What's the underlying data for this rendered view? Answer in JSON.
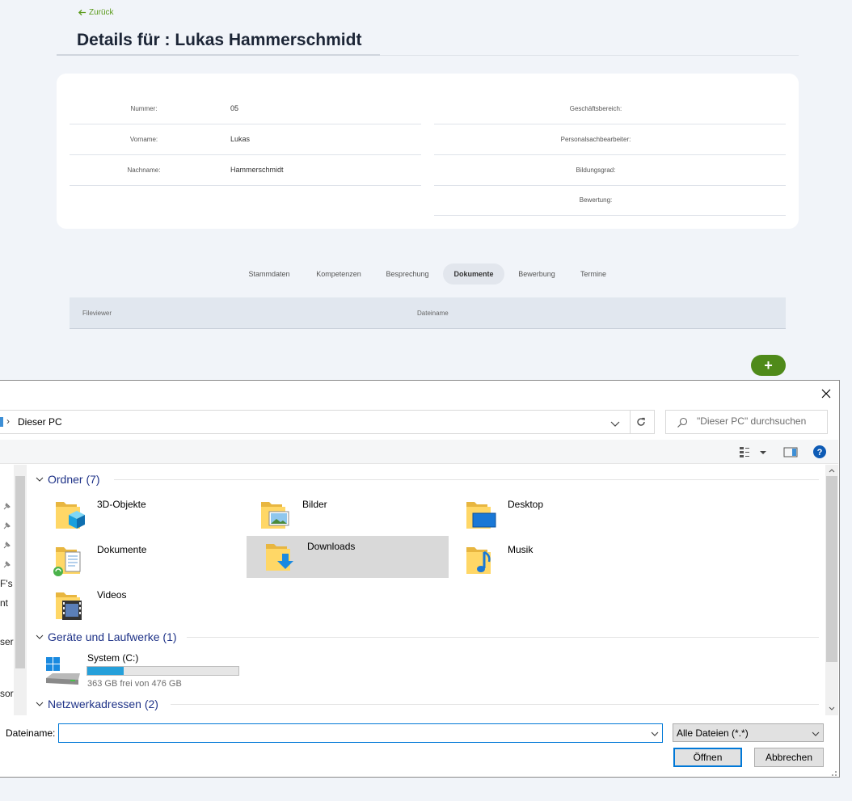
{
  "page": {
    "back_label": "Zurück",
    "title": "Details für : Lukas Hammerschmidt"
  },
  "details": {
    "left": [
      {
        "label": "Nummer:",
        "value": "05"
      },
      {
        "label": "Vorname:",
        "value": "Lukas"
      },
      {
        "label": "Nachname:",
        "value": "Hammerschmidt"
      }
    ],
    "right": [
      {
        "label": "Geschäftsbereich:"
      },
      {
        "label": "Personalsachbearbeiter:"
      },
      {
        "label": "Bildungsgrad:"
      },
      {
        "label": "Bewertung:"
      }
    ]
  },
  "tabs": [
    {
      "label": "Stammdaten"
    },
    {
      "label": "Kompetenzen"
    },
    {
      "label": "Besprechung"
    },
    {
      "label": "Dokumente",
      "active": true
    },
    {
      "label": "Bewerbung"
    },
    {
      "label": "Termine"
    }
  ],
  "table": {
    "columns": [
      "Fileviewer",
      "Dateiname"
    ]
  },
  "add_button": {
    "label": "+",
    "color": "#4f8a1a"
  },
  "dialog": {
    "address_path": "Dieser PC",
    "search_placeholder": "\"Dieser PC\" durchsuchen",
    "nav_fragments": [
      "F's",
      "nt",
      "sers",
      "sor"
    ],
    "groups": {
      "folders": "Ordner (7)",
      "drives": "Geräte und Laufwerke (1)",
      "network": "Netzwerkadressen (2)"
    },
    "folders": [
      {
        "name": "3D-Objekte",
        "icon": "3d-objects-folder-icon"
      },
      {
        "name": "Bilder",
        "icon": "pictures-folder-icon"
      },
      {
        "name": "Desktop",
        "icon": "desktop-folder-icon"
      },
      {
        "name": "Dokumente",
        "icon": "documents-folder-icon"
      },
      {
        "name": "Downloads",
        "icon": "downloads-folder-icon",
        "selected": true
      },
      {
        "name": "Musik",
        "icon": "music-folder-icon"
      },
      {
        "name": "Videos",
        "icon": "videos-folder-icon"
      }
    ],
    "drive": {
      "name": "System (C:)",
      "free_text": "363 GB frei von 476 GB",
      "used_fraction": 0.24
    },
    "filename_label": "Dateiname:",
    "filename_value": "",
    "filetype": "Alle Dateien (*.*)",
    "open_label": "Öffnen",
    "cancel_label": "Abbrechen",
    "accent": "#0078d7"
  }
}
